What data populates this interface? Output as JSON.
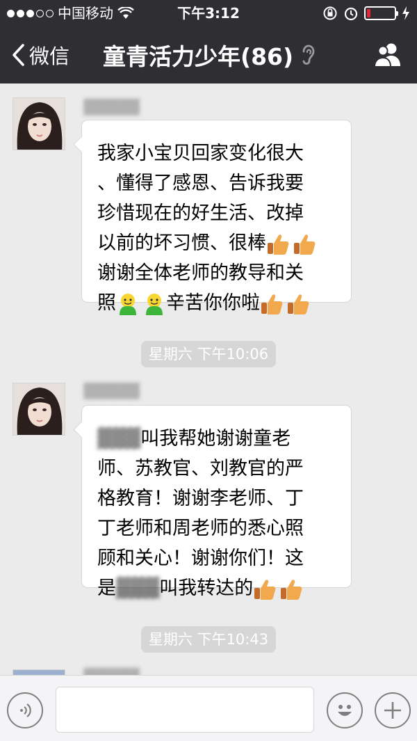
{
  "status_bar": {
    "carrier": "中国移动",
    "time": "下午3:12"
  },
  "nav": {
    "back_label": "微信",
    "title": "童青活力少年(86)",
    "icons": [
      "chevron-left-icon",
      "ear-icon",
      "group-members-icon"
    ]
  },
  "messages": [
    {
      "sender": "",
      "lines": [
        "我家小宝贝回家变化很大",
        "、懂得了感恩、告诉我要",
        "珍惜现在的好生活、改掉",
        "以前的坏习惯、很棒",
        "谢谢全体老师的教导和关",
        "照",
        "辛苦你你啦"
      ],
      "emoji": [
        "thumbs-up-icon",
        "thumbs-up-icon",
        "green-smiley-icon",
        "green-smiley-icon",
        "thumbs-up-icon",
        "thumbs-up-icon"
      ]
    },
    {
      "time": "星期六 下午10:06"
    },
    {
      "sender": "",
      "lines": [
        "叫我帮她谢谢童老",
        "师、苏教官、刘教官的严",
        "格教育！谢谢李老师、丁",
        "丁老师和周老师的悉心照",
        "顾和关心！谢谢你们！这",
        "是",
        "叫我转达的"
      ],
      "emoji": [
        "thumbs-up-icon",
        "thumbs-up-icon"
      ]
    },
    {
      "time": "星期六 下午10:43"
    }
  ],
  "input": {
    "value": "",
    "icons": [
      "voice-icon",
      "smiley-face-icon",
      "plus-icon"
    ]
  },
  "colors": {
    "bar": "#2e2e33",
    "background": "#ebebeb",
    "bubble": "#ffffff",
    "time_badge": "#d6d6d6"
  }
}
